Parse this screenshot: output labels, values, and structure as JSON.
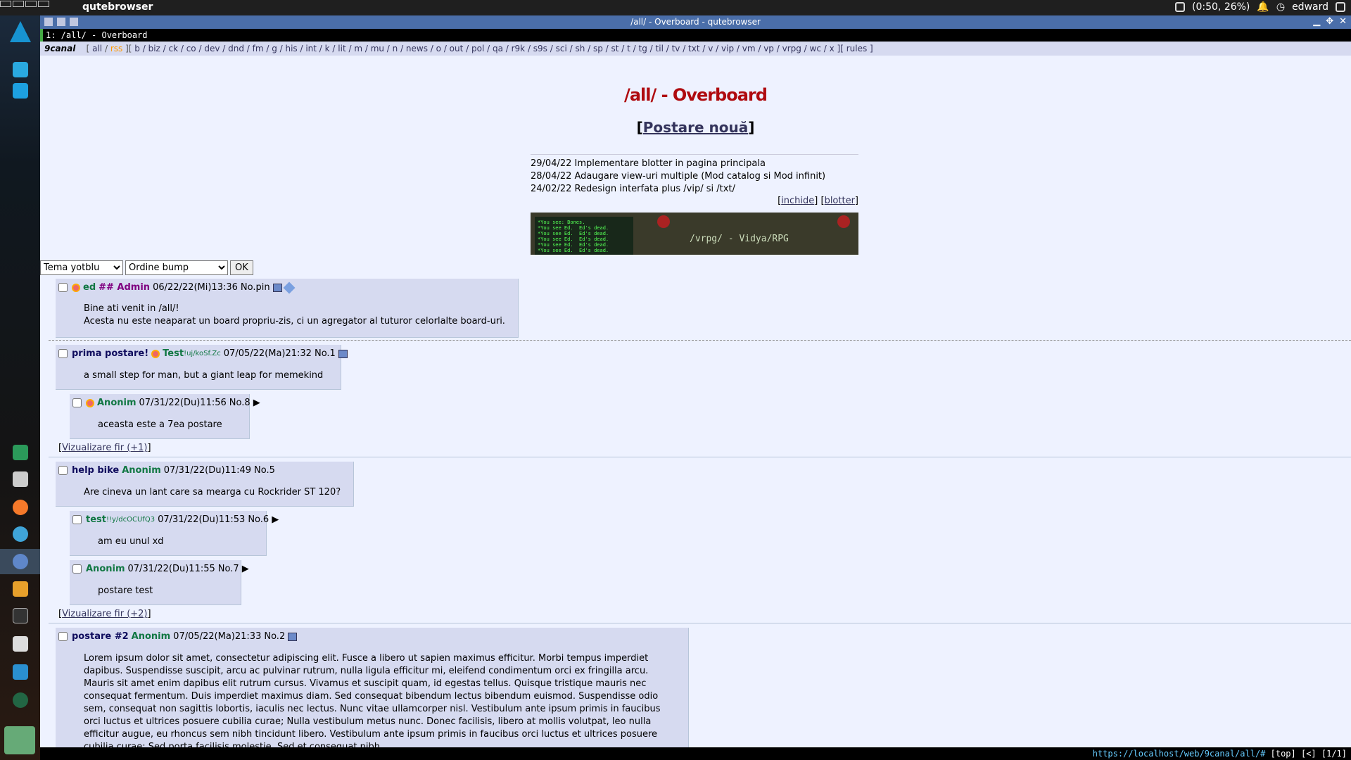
{
  "desktop": {
    "app_title": "qutebrowser",
    "battery": "(0:50, 26%)",
    "user": "edward"
  },
  "window": {
    "title": "/all/ - Overboard - qutebrowser",
    "tab": "1: /all/ - Overboard"
  },
  "boardlist": {
    "logo": "9canal",
    "prefix": "[",
    "all": "all",
    "rss": "rss",
    "mid": "][",
    "boards": "b / biz / ck / co / dev / dnd / fm / g / his / int / k / lit / m / mu / n / news / o / out / pol / qa / r9k / s9s / sci / sh / sp / st / t / tg / til / tv / txt / v / vip / vm / vp / vrpg / wc / x",
    "rules": "][ rules ]"
  },
  "board_title": "/all/ - Overboard",
  "new_post": "Postare nouă",
  "blotter": [
    "29/04/22 Implementare blotter in pagina principala",
    "28/04/22 Adaugare view-uri multiple (Mod catalog si Mod infinit)",
    "24/02/22 Redesign interfata plus /vip/ si /txt/"
  ],
  "blotter_links": {
    "close": "inchide",
    "blotter": "blotter"
  },
  "banner": {
    "text": "/vrpg/ - Vidya/RPG",
    "screen": "*You see: Bones.\n*You see Ed.  Ed's dead.\n*You see Ed.  Ed's dead.\n*You see Ed.  Ed's dead.\n*You see Ed.  Ed's dead.\n*You see Ed.  Ed's dead."
  },
  "controls": {
    "theme": "Tema yotblu",
    "order": "Ordine bump",
    "ok": "OK"
  },
  "posts": {
    "pin": {
      "name": "ed",
      "cap": "## Admin",
      "date": "06/22/22(Mi)13:36",
      "no": "No.pin",
      "line1": "Bine ati venit in /all/!",
      "line2": "Acesta nu este neaparat un board propriu-zis, ci un agregator al tuturor celorlalte board-uri."
    },
    "op1": {
      "subject": "prima postare!",
      "name": "Test",
      "trip": "!uj/koSf.Zc",
      "date": "07/05/22(Ma)21:32",
      "no": "No.1",
      "text": "a small step for man, but a giant leap for memekind"
    },
    "r8": {
      "name": "Anonim",
      "date": "07/31/22(Du)11:56",
      "no": "No.8 ▶",
      "text": "aceasta este a 7ea postare"
    },
    "view1": "Vizualizare fir (+1)",
    "op5": {
      "subject": "help bike",
      "name": "Anonim",
      "date": "07/31/22(Du)11:49",
      "no": "No.5",
      "text": "Are cineva un lant care sa mearga cu Rockrider ST 120?"
    },
    "r6": {
      "name": "test",
      "trip": "!!y/dcOCUfQ3",
      "date": "07/31/22(Du)11:53",
      "no": "No.6 ▶",
      "text": "am eu unul xd"
    },
    "r7": {
      "name": "Anonim",
      "date": "07/31/22(Du)11:55",
      "no": "No.7 ▶",
      "text": "postare test"
    },
    "view2": "Vizualizare fir (+2)",
    "op2": {
      "subject": "postare #2",
      "name": "Anonim",
      "date": "07/05/22(Ma)21:33",
      "no": "No.2",
      "text": "Lorem ipsum dolor sit amet, consectetur adipiscing elit. Fusce a libero ut sapien maximus efficitur. Morbi tempus imperdiet dapibus. Suspendisse suscipit, arcu ac pulvinar rutrum, nulla ligula efficitur mi, eleifend condimentum orci ex fringilla arcu. Mauris sit amet enim dapibus elit rutrum cursus. Vivamus et suscipit quam, id egestas tellus. Quisque tristique mauris nec consequat fermentum. Duis imperdiet maximus diam. Sed consequat bibendum lectus bibendum euismod. Suspendisse odio sem, consequat non sagittis lobortis, iaculis nec lectus. Nunc vitae ullamcorper nisl. Vestibulum ante ipsum primis in faucibus orci luctus et ultrices posuere cubilia curae; Nulla vestibulum metus nunc. Donec facilisis, libero at mollis volutpat, leo nulla efficitur augue, eu rhoncus sem nibh tincidunt libero. Vestibulum ante ipsum primis in faucibus orci luctus et ultrices posuere cubilia curae; Sed porta facilisis molestie. Sed et consequat nibh."
    }
  },
  "statusbar": {
    "url": "https://localhost/web/9canal/all/#",
    "info": "[top] [<] [1/1]"
  }
}
